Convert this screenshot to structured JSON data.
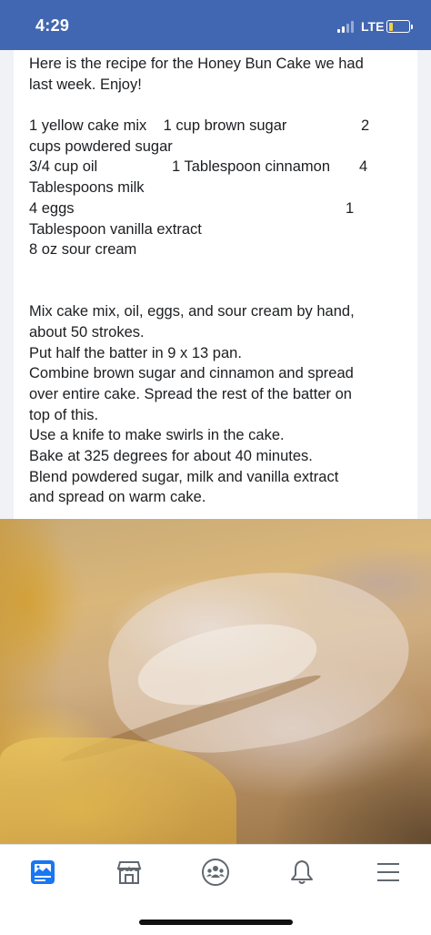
{
  "status_bar": {
    "time": "4:29",
    "network": "LTE",
    "battery_level": 0.2,
    "battery_color": "#f4d142",
    "bar_color": "#4267b2"
  },
  "post": {
    "intro": [
      "Here is the recipe for the Honey Bun Cake we had",
      "last week.  Enjoy!"
    ],
    "ingredients": {
      "line1_left": "1 yellow cake mix    1 cup brown sugar",
      "line1_right": "2",
      "line2": "cups powdered sugar",
      "line3_left": "3/4 cup oil",
      "line3_mid": "1 Tablespoon cinnamon",
      "line3_right": "4",
      "line4": "Tablespoons milk",
      "line5_left": "4 eggs",
      "line5_right": "1",
      "line6": "Tablespoon vanilla extract",
      "line7": "8 oz sour cream"
    },
    "directions": [
      "Mix cake mix, oil, eggs, and sour cream by hand,",
      "about 50 strokes.",
      "Put half the batter in 9 x 13 pan.",
      "Combine brown sugar and cinnamon and spread",
      "over entire cake.  Spread the rest of the batter on",
      "top of this.",
      "Use a knife to make swirls in the cake.",
      "Bake at 325 degrees for about 40 minutes.",
      "Blend powdered sugar, milk and vanilla extract",
      "and spread on warm cake."
    ],
    "photo_subject": "honey bun cake close-up"
  },
  "nav": {
    "items": [
      {
        "icon": "news-feed-icon",
        "active": true
      },
      {
        "icon": "marketplace-icon",
        "active": false
      },
      {
        "icon": "groups-icon",
        "active": false
      },
      {
        "icon": "notifications-bell-icon",
        "active": false
      },
      {
        "icon": "menu-icon",
        "active": false
      }
    ],
    "active_color": "#1877f2",
    "inactive_color": "#606770"
  }
}
